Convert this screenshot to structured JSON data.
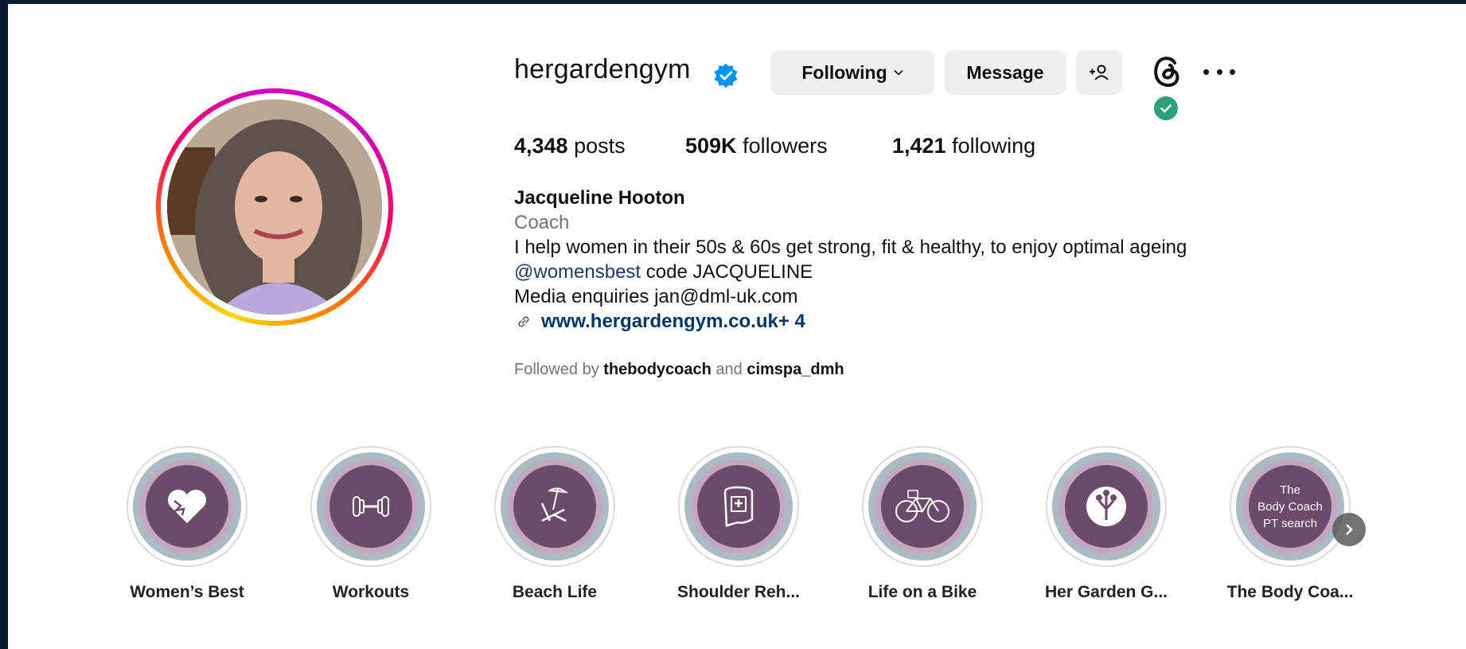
{
  "profile": {
    "username": "hergardengym",
    "buttons": {
      "following": "Following",
      "message": "Message"
    },
    "stats": {
      "posts_count": "4,348",
      "posts_label": "posts",
      "followers_count": "509K",
      "followers_label": "followers",
      "following_count": "1,421",
      "following_label": "following"
    },
    "bio": {
      "name": "Jacqueline Hooton",
      "category": "Coach",
      "line1": "I help women in their 50s & 60s get strong, fit & healthy, to enjoy optimal ageing",
      "mention": "@womensbest",
      "mention_suffix": " code JACQUELINE",
      "line3": "Media enquiries jan@dml-uk.com",
      "link": "www.hergardengym.co.uk",
      "link_more": " + 4"
    },
    "followed_by": {
      "prefix": "Followed by ",
      "user1": "thebodycoach",
      "joiner": " and ",
      "user2": "cimspa_dmh"
    }
  },
  "highlights": [
    {
      "label": "Women’s Best",
      "icon": "heart-lion-icon"
    },
    {
      "label": "Workouts",
      "icon": "dumbbell-icon"
    },
    {
      "label": "Beach Life",
      "icon": "beach-chair-icon"
    },
    {
      "label": "Shoulder Reh...",
      "icon": "bandage-icon"
    },
    {
      "label": "Life on a Bike",
      "icon": "bicycle-icon"
    },
    {
      "label": "Her Garden G...",
      "icon": "tree-icon"
    },
    {
      "label": "The Body Coa...",
      "icon": "text-cover",
      "cover_lines": [
        "The",
        "Body Coach",
        "PT search"
      ]
    }
  ],
  "colors": {
    "verified_blue": "#0095f6",
    "highlight_fill": "#6b4a6a",
    "threads_badge": "#2aa37c",
    "link_color": "#00376b"
  }
}
